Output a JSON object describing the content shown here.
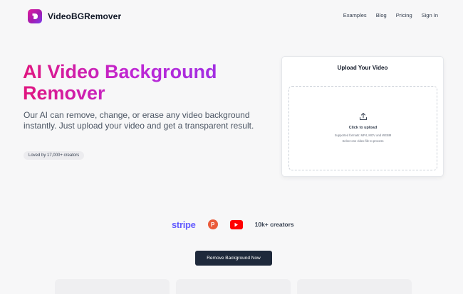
{
  "brand": {
    "name": "VideoBGRemover",
    "accent": "#c026d3"
  },
  "nav": {
    "items": [
      "Examples",
      "Blog",
      "Pricing",
      "Sign In"
    ]
  },
  "hero": {
    "title": "AI Video Background Remover",
    "description": "Our AI can remove, change, or erase any video background instantly. Just upload your video and get a transparent result.",
    "badge": "Loved by 17,000+ creators"
  },
  "upload": {
    "title": "Upload Your Video",
    "click_label": "Click to upload",
    "formats": "Supported formats: MP4, MOV and WEBM",
    "hint": "Select one video file to process",
    "icon": "upload-icon"
  },
  "logos": {
    "stripe": "stripe",
    "producthunt": "P",
    "creators": "10k+ creators"
  },
  "cta": {
    "label": "Remove Background Now"
  }
}
